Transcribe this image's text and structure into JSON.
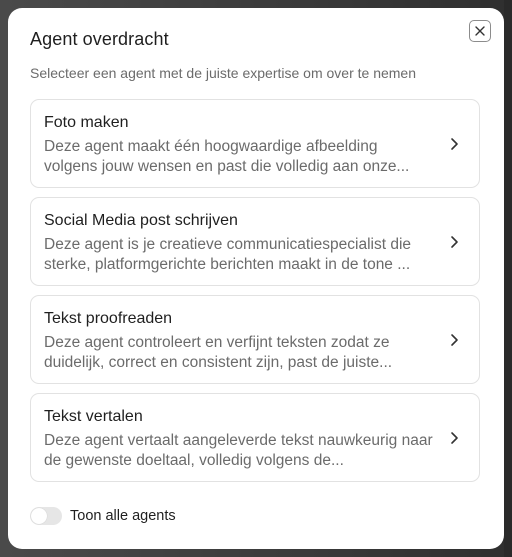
{
  "dialog": {
    "title": "Agent overdracht",
    "subtitle": "Selecteer een agent met de juiste expertise om over te nemen",
    "close_icon": "close-icon"
  },
  "agents": [
    {
      "title": "Foto maken",
      "description": "Deze agent maakt één hoogwaardige afbeelding volgens jouw wensen en past die volledig aan onze..."
    },
    {
      "title": "Social Media post schrijven",
      "description": "Deze agent is je creatieve communicatiespecialist die sterke, platformgerichte berichten maakt in de tone ..."
    },
    {
      "title": "Tekst proofreaden",
      "description": "Deze agent controleert en verfijnt teksten zodat ze duidelijk, correct en consistent zijn, past de juiste..."
    },
    {
      "title": "Tekst vertalen",
      "description": "Deze agent vertaalt aangeleverde tekst nauwkeurig naar de gewenste doeltaal, volledig volgens de..."
    }
  ],
  "toggle": {
    "label": "Toon alle agents",
    "enabled": false
  },
  "colors": {
    "text_primary": "#1f1f1f",
    "text_secondary": "#6b6b6b",
    "border": "#e2e2e2",
    "toggle_off": "#e6e6e6"
  }
}
